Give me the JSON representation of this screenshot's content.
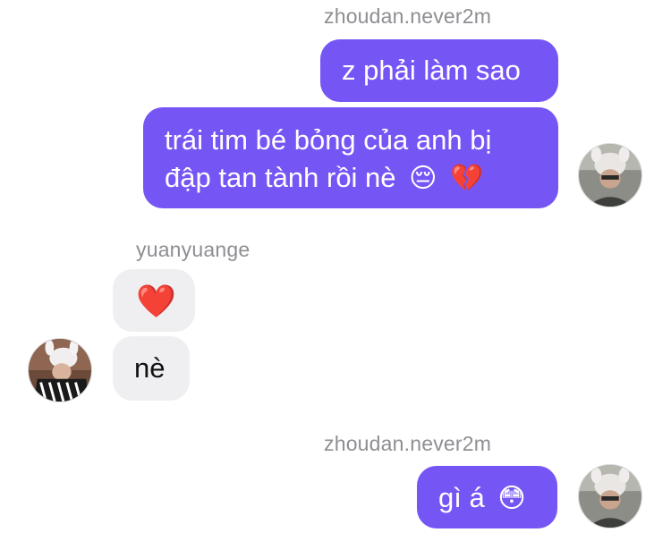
{
  "conversation": {
    "group1": {
      "sender": "zhoudan.never2m",
      "msg1": "z phải làm sao",
      "msg2_line1": "trái tim bé bỏng của anh bị",
      "msg2_line2": "đập tan tành rồi nè",
      "msg2_emoji1": "😔",
      "msg2_emoji2": "💔"
    },
    "group2": {
      "sender": "yuanyuange",
      "msg1_emoji": "❤️",
      "msg2": "nè"
    },
    "group3": {
      "sender": "zhoudan.never2m",
      "msg1": "gì á",
      "msg1_emoji": "😳"
    }
  },
  "colors": {
    "outgoing_bubble": "#7655f5",
    "incoming_bubble": "#efeff1",
    "sender_name": "#8e8e93"
  },
  "icons": {
    "avatar_self": "user-avatar-photo",
    "avatar_other": "user-avatar-photo"
  }
}
